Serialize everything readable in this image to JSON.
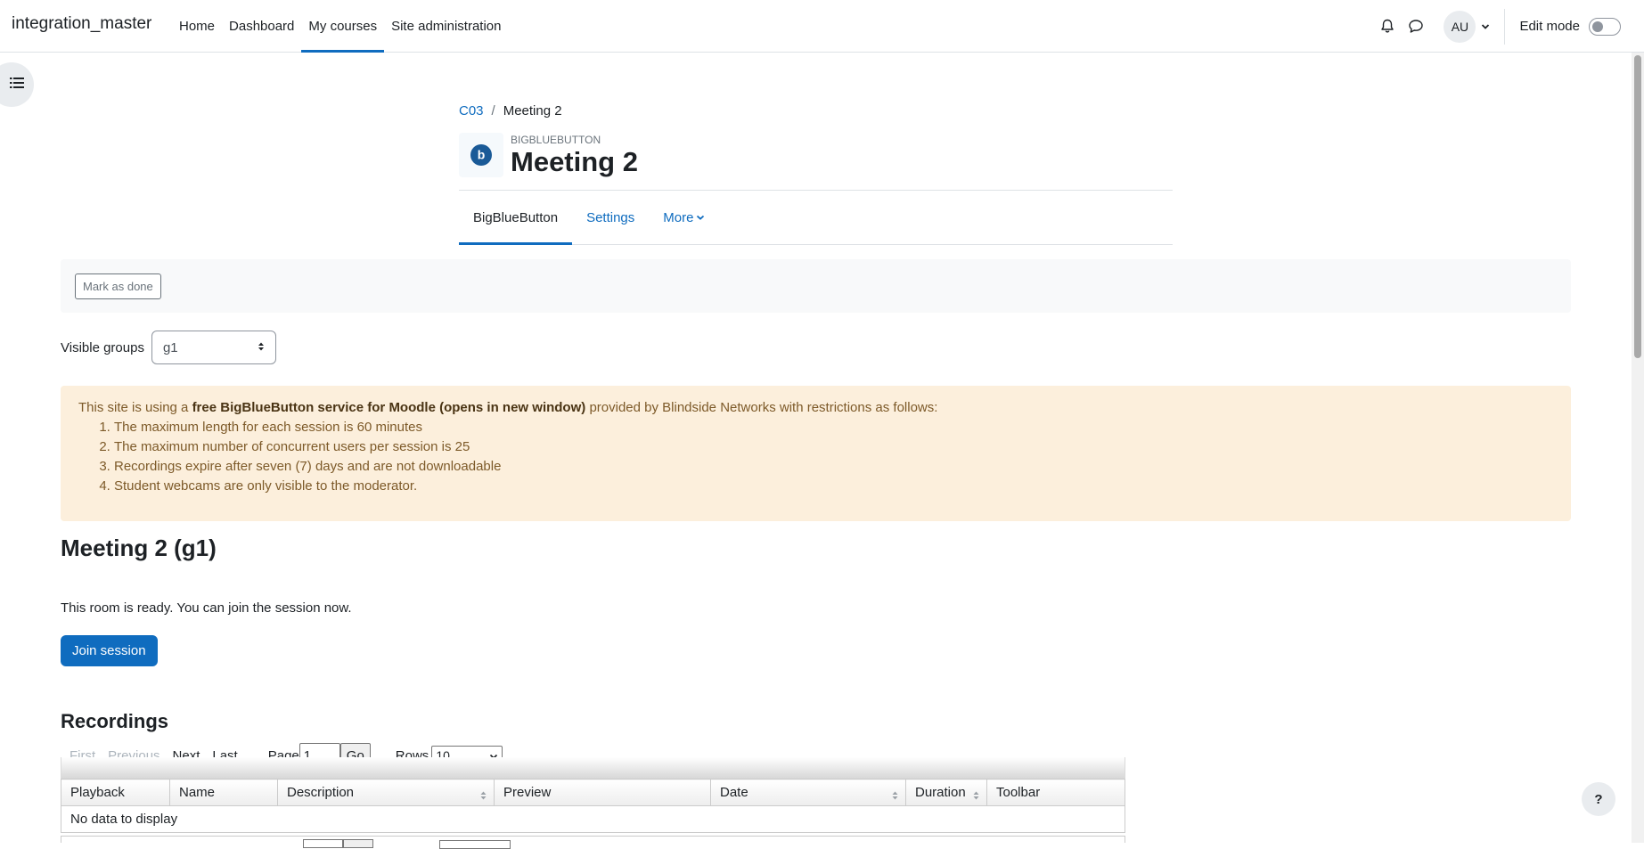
{
  "navbar": {
    "brand": "integration_master",
    "items": [
      {
        "label": "Home",
        "active": false
      },
      {
        "label": "Dashboard",
        "active": false
      },
      {
        "label": "My courses",
        "active": true
      },
      {
        "label": "Site administration",
        "active": false
      }
    ],
    "avatar_initials": "AU",
    "edit_mode_label": "Edit mode",
    "edit_mode_on": false,
    "icons": [
      "bell-icon",
      "chat-icon",
      "chevron-down-icon",
      "course-index-icon"
    ]
  },
  "breadcrumb": [
    {
      "label": "C03",
      "link": true
    },
    {
      "label": "Meeting 2",
      "link": false
    }
  ],
  "breadcrumb_separator": "/",
  "header": {
    "modtype": "BIGBLUEBUTTON",
    "title": "Meeting 2",
    "icon_letter": "b"
  },
  "secondary_nav": [
    {
      "label": "BigBlueButton",
      "active": true
    },
    {
      "label": "Settings",
      "active": false
    },
    {
      "label": "More",
      "active": false
    }
  ],
  "completion": {
    "button_label": "Mark as done"
  },
  "groups": {
    "label": "Visible groups",
    "selected": "g1"
  },
  "alert": {
    "prefix": "This site is using a",
    "bold": "free BigBlueButton service for Moodle (opens in new window)",
    "suffix": "provided by Blindside Networks with restrictions as follows:",
    "items": [
      "The maximum length for each session is 60 minutes",
      "The maximum number of concurrent users per session is 25",
      "Recordings expire after seven (7) days and are not downloadable",
      "Student webcams are only visible to the moderator."
    ]
  },
  "room": {
    "title": "Meeting 2 (g1)",
    "status": "This room is ready. You can join the session now.",
    "join_label": "Join session"
  },
  "recordings": {
    "title": "Recordings",
    "paginator": {
      "first": "First",
      "previous": "Previous",
      "next": "Next",
      "last": "Last",
      "page_label": "Page",
      "page_value": "1",
      "go_label": "Go",
      "rows_label": "Rows",
      "rows_value": "10"
    },
    "columns": [
      "Playback",
      "Name",
      "Description",
      "Preview",
      "Date",
      "Duration",
      "Toolbar"
    ],
    "empty_message": "No data to display"
  },
  "help_label": "?",
  "colors": {
    "primary": "#0f6cbf",
    "alert_bg": "#fcefdc",
    "alert_text": "#7d5a29",
    "bbb_blue": "#1a5a97"
  }
}
